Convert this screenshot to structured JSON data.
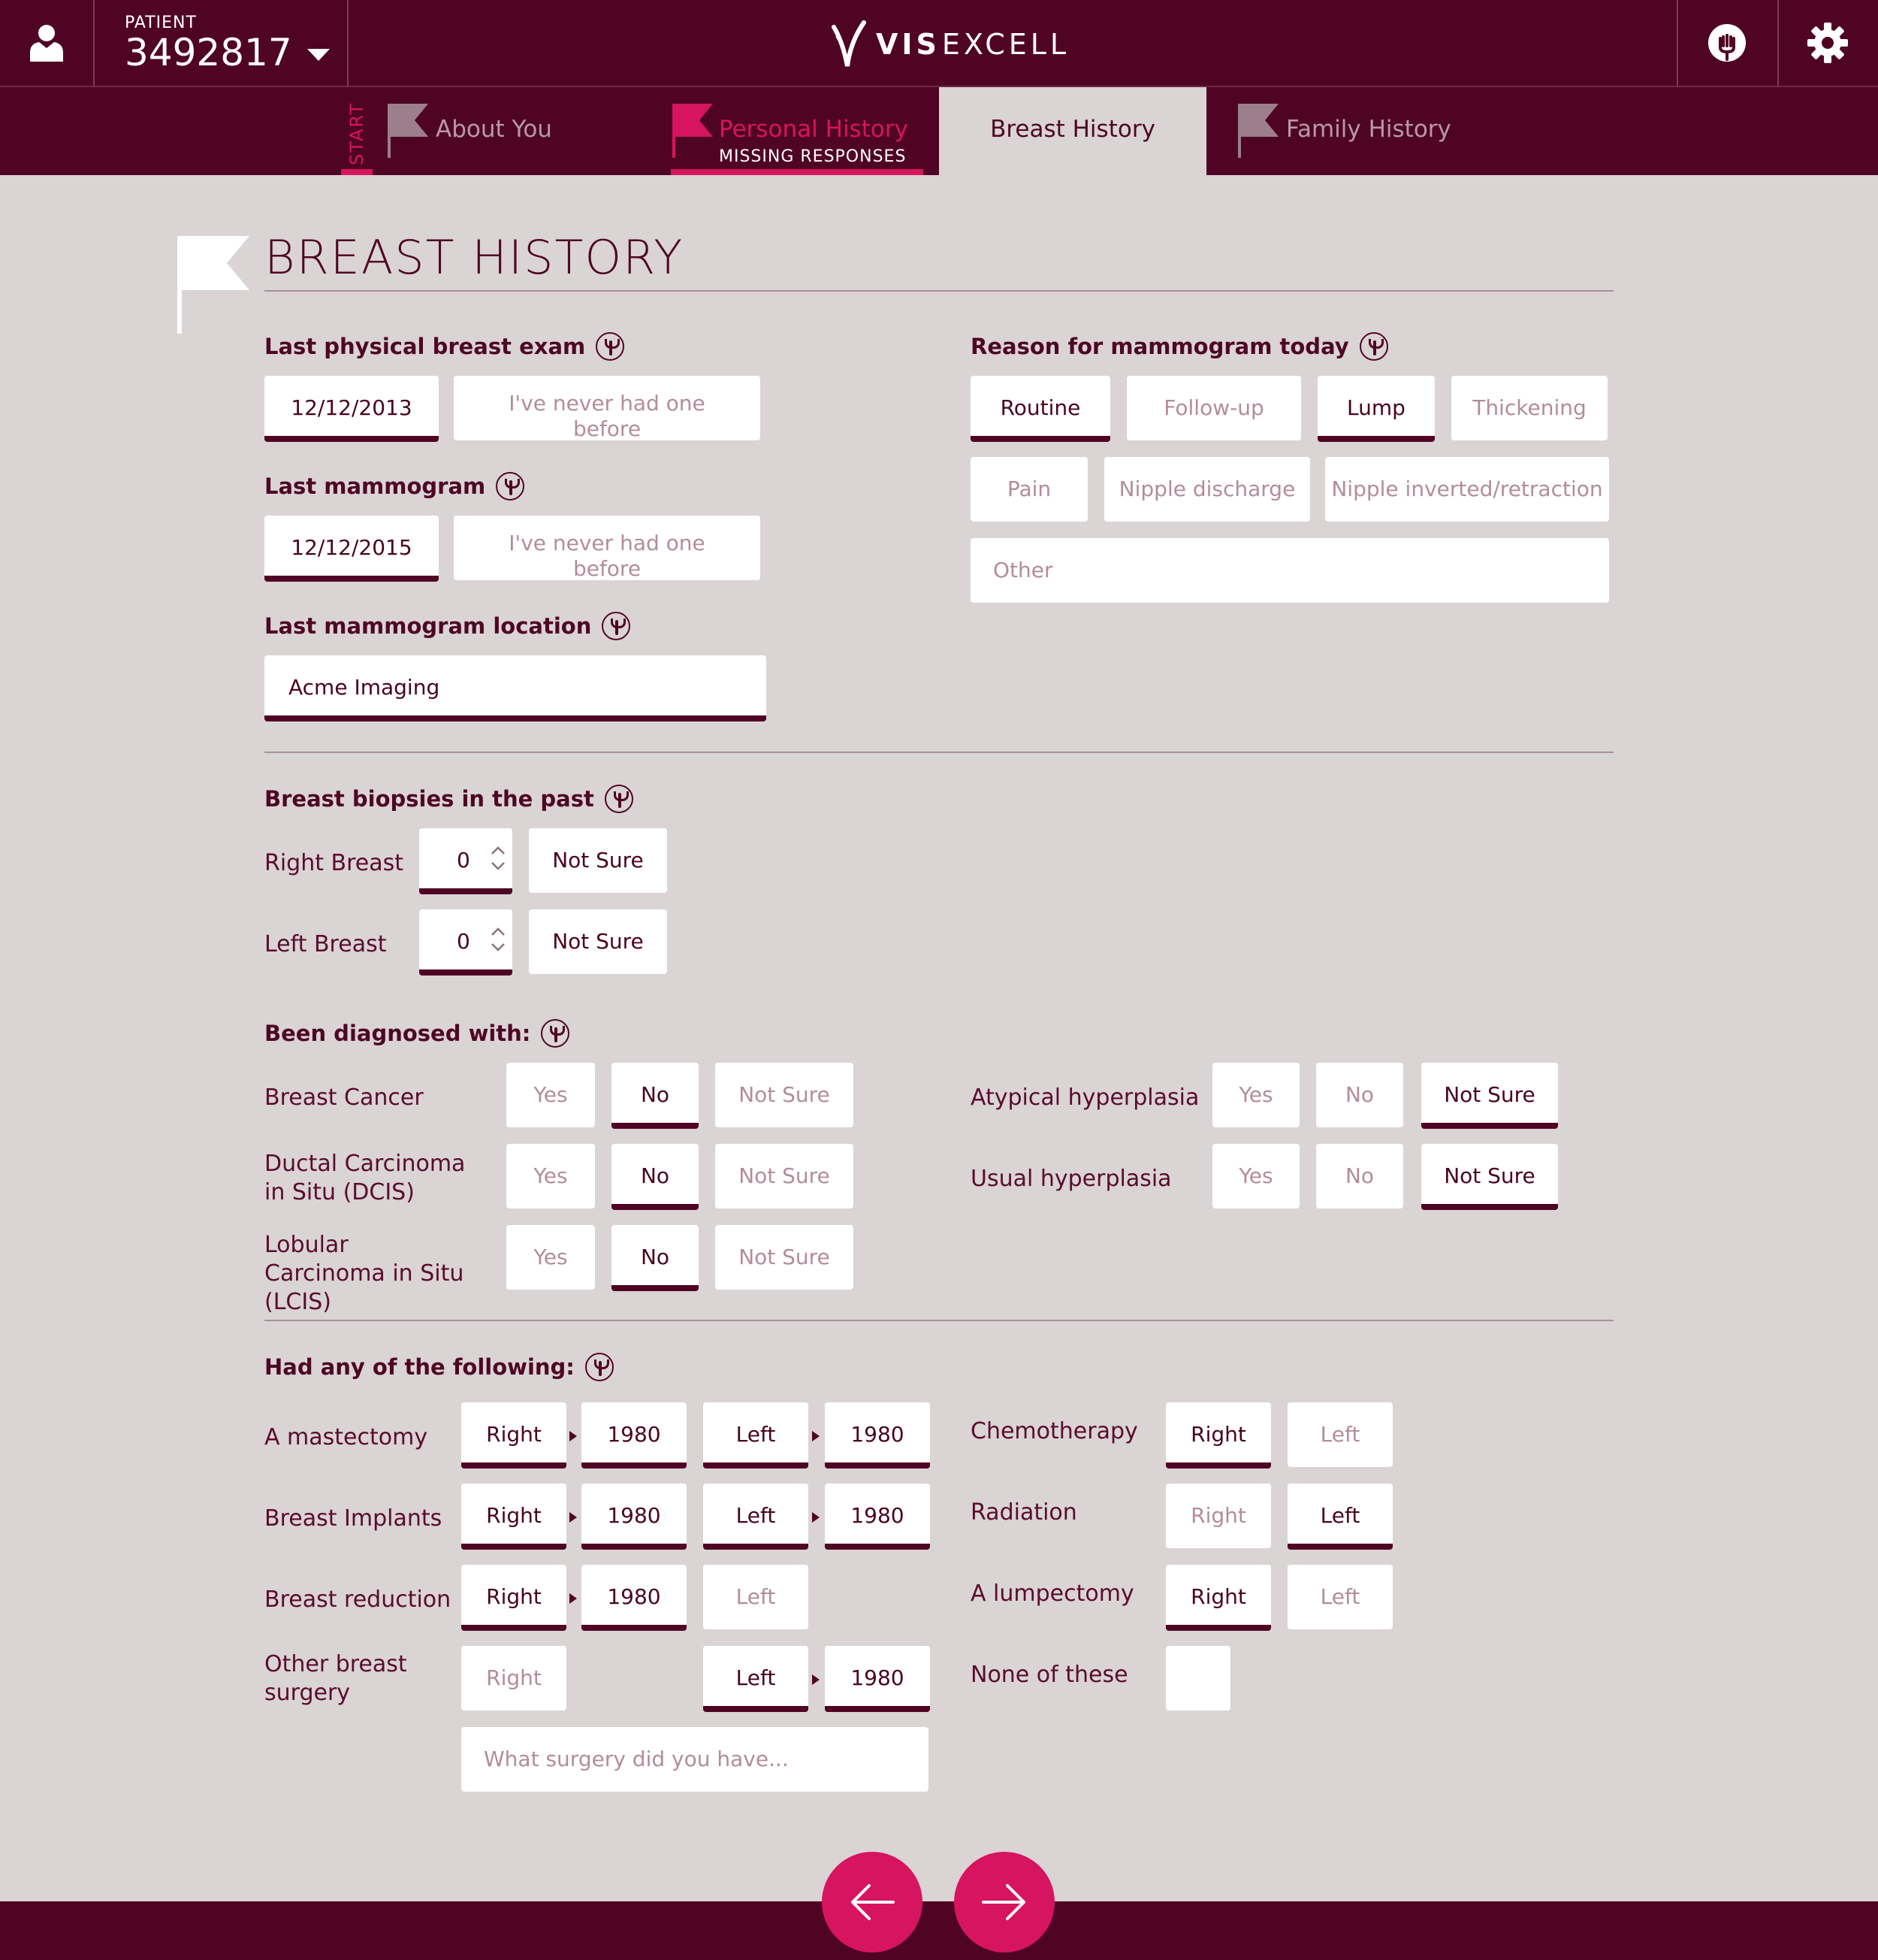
{
  "header": {
    "patient_label": "PATIENT",
    "patient_id": "3492817",
    "brand_vis": "VIS",
    "brand_excell": "EXCELL"
  },
  "tabs": {
    "start": "START",
    "about": "About You",
    "personal": "Personal History",
    "personal_sub": "MISSING RESPONSES",
    "breast": "Breast History",
    "family": "Family History"
  },
  "page_title": "BREAST HISTORY",
  "exam": {
    "label": "Last physical breast exam",
    "date": "12/12/2013",
    "never": "I've never had one before"
  },
  "mammo": {
    "label": "Last mammogram",
    "date": "12/12/2015",
    "never": "I've never had one before"
  },
  "location": {
    "label": "Last mammogram location",
    "value": "Acme Imaging"
  },
  "reason": {
    "label": "Reason for mammogram today",
    "options": [
      "Routine",
      "Follow-up",
      "Lump",
      "Thickening",
      "Pain",
      "Nipple discharge",
      "Nipple inverted/retraction"
    ],
    "other_placeholder": "Other"
  },
  "biopsies": {
    "label": "Breast biopsies in the past",
    "right_label": "Right Breast",
    "right_value": "0",
    "left_label": "Left Breast",
    "left_value": "0",
    "not_sure": "Not Sure"
  },
  "diagnosed": {
    "label": "Been diagnosed with:",
    "yes": "Yes",
    "no": "No",
    "not_sure": "Not Sure",
    "items": [
      "Breast Cancer",
      "Ductal Carcinoma in Situ (DCIS)",
      "Lobular Carcinoma in Situ (LCIS)",
      "Atypical hyperplasia",
      "Usual hyperplasia"
    ]
  },
  "following": {
    "label": "Had any of the following:",
    "right": "Right",
    "left": "Left",
    "year": "1980",
    "items": [
      "A mastectomy",
      "Breast Implants",
      "Breast reduction",
      "Other breast surgery",
      "Chemotherapy",
      "Radiation",
      "A lumpectomy",
      "None of these"
    ],
    "surgery_placeholder": "What surgery did you have..."
  },
  "colors": {
    "primary": "#500424",
    "accent": "#d7145f",
    "background": "#dad4d5"
  },
  "icons": [
    "user-icon",
    "chevron-down-icon",
    "logo-icon",
    "help-hand-icon",
    "gear-icon",
    "flag-icon",
    "info-hand-icon",
    "spinner-icon",
    "arrow-left-icon",
    "arrow-right-icon"
  ]
}
